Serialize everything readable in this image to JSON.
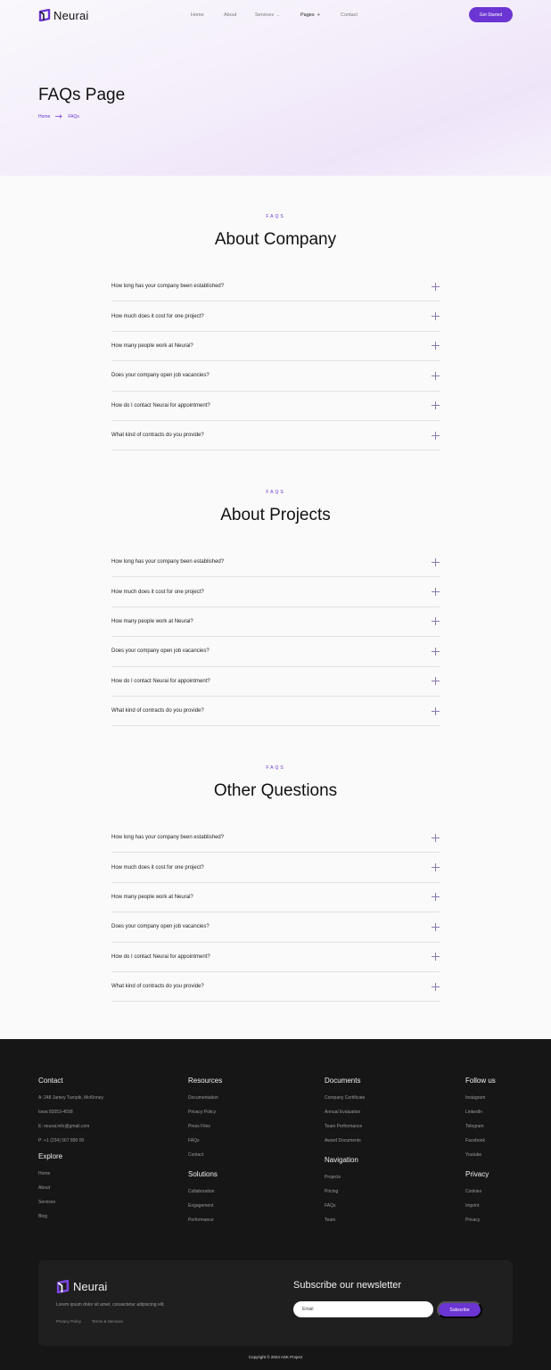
{
  "brand": {
    "name": "Neurai",
    "accent": "#6a35d2"
  },
  "nav": {
    "links": [
      "Home",
      "About",
      "Services",
      "Pages",
      "Contact"
    ],
    "cta": "Get Started"
  },
  "hero": {
    "title": "FAQs Page",
    "breadcrumb": [
      "Home",
      "FAQs"
    ]
  },
  "sections": [
    {
      "eyebrow": "FAQS",
      "title": "About Company",
      "questions": [
        "How long has your company been established?",
        "How much does it cost for one project?",
        "How many people work at Neurai?",
        "Does your company open job vacancies?",
        "How do I contact Neurai for appointment?",
        "What kind of contracts do you provide?"
      ]
    },
    {
      "eyebrow": "FAQS",
      "title": "About Projects",
      "questions": [
        "How long has your company been established?",
        "How much does it cost for one project?",
        "How many people work at Neurai?",
        "Does your company open job vacancies?",
        "How do I contact Neurai for appointment?",
        "What kind of contracts do you provide?"
      ]
    },
    {
      "eyebrow": "FAQS",
      "title": "Other Questions",
      "questions": [
        "How long has your company been established?",
        "How much does it cost for one project?",
        "How many people work at Neurai?",
        "Does your company open job vacancies?",
        "How do I contact Neurai for appointment?",
        "What kind of contracts do you provide?"
      ]
    }
  ],
  "footer": {
    "contact": {
      "title": "Contact",
      "lines": [
        "A: 248 Jamey Turnpik, McKinney",
        "Iowa 82053-4558",
        "E: neurai.info@gmail.com",
        "P: +1 (234) 567 890 00"
      ]
    },
    "explore": {
      "title": "Explore",
      "links": [
        "Home",
        "About",
        "Services",
        "Blog"
      ]
    },
    "resources": {
      "title": "Resources",
      "links": [
        "Documentation",
        "Privacy Policy",
        "Press Files",
        "FAQs",
        "Contact"
      ]
    },
    "solutions": {
      "title": "Solutions",
      "links": [
        "Collaboration",
        "Engagement",
        "Performance"
      ]
    },
    "documents": {
      "title": "Documents",
      "links": [
        "Company Certificate",
        "Annual Evaluation",
        "Team Performance",
        "Award Documents"
      ]
    },
    "navigation": {
      "title": "Navigation",
      "links": [
        "Projects",
        "Pricing",
        "FAQs",
        "Team"
      ]
    },
    "follow": {
      "title": "Follow us",
      "links": [
        "Instagram",
        "LinkedIn",
        "Telegram",
        "Facebook",
        "Youtube"
      ]
    },
    "privacy": {
      "title": "Privacy",
      "links": [
        "Cookies",
        "Imprint",
        "Privacy"
      ]
    },
    "newsletter": {
      "brand": "Neurai",
      "description": "Lorem ipsum dolor sit amet, consectetur adipiscing elit.",
      "links": [
        "Privacy Policy",
        "Terms & Services"
      ],
      "title": "Subscribe our newsletter",
      "placeholder": "Email",
      "button": "Subscribe"
    },
    "copyright": "Copyright © 2024 ASK Project"
  }
}
